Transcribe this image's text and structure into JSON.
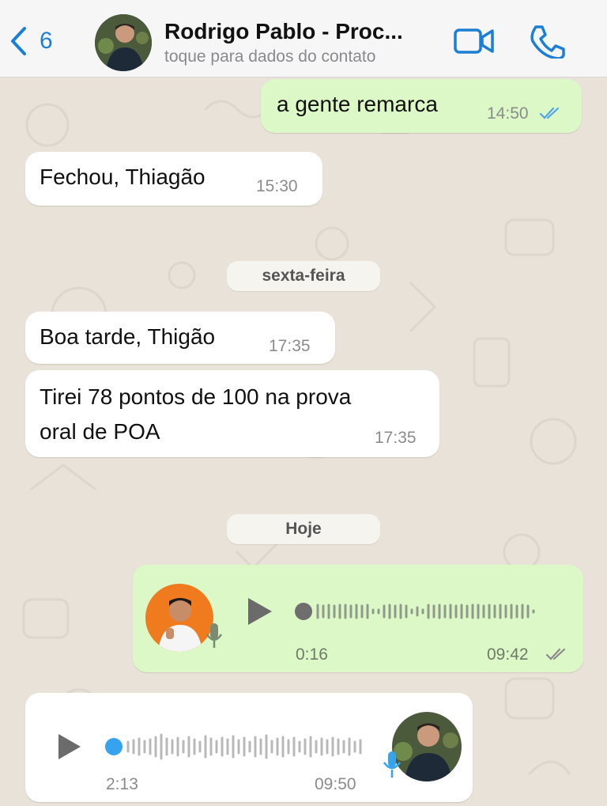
{
  "header": {
    "back_count": "6",
    "contact_name": "Rodrigo Pablo - Proc...",
    "contact_subtitle": "toque para dados do contato"
  },
  "messages": [
    {
      "text": "a gente remarca",
      "time": "14:50"
    },
    {
      "text": "Fechou, Thiagão",
      "time": "15:30"
    },
    {
      "date": "sexta-feira"
    },
    {
      "text": "Boa tarde, Thigão",
      "time": "17:35"
    },
    {
      "text_line1": "Tirei 78 pontos de 100 na prova",
      "text_line2": "oral de POA",
      "time": "17:35"
    },
    {
      "date": "Hoje"
    },
    {
      "type": "audio",
      "duration": "0:16",
      "time": "09:42"
    },
    {
      "type": "audio",
      "duration": "2:13",
      "time": "09:50"
    }
  ],
  "colors": {
    "accent": "#1b7fd6",
    "outgoing_bubble": "#dcf8c6",
    "incoming_bubble": "#ffffff",
    "read_ticks": "#4fa6e8",
    "audio_dot_blue": "#36a3ee"
  }
}
